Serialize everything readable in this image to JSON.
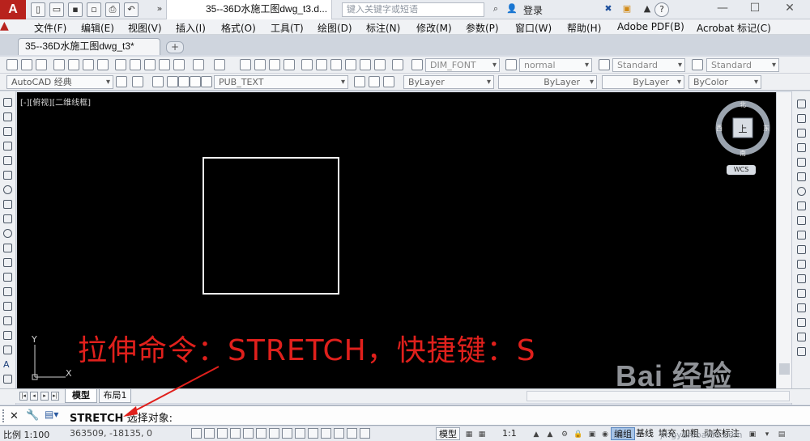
{
  "app": {
    "logo": "A",
    "document_title": "35--36D水施工图dwg_t3.d...",
    "search_placeholder": "键入关键字或短语",
    "login": "登录",
    "minimize": "—",
    "maximize": "☐",
    "close": "✕",
    "help": "?"
  },
  "menu": [
    "文件(F)",
    "编辑(E)",
    "视图(V)",
    "插入(I)",
    "格式(O)",
    "工具(T)",
    "绘图(D)",
    "标注(N)",
    "修改(M)",
    "参数(P)",
    "窗口(W)",
    "帮助(H)",
    "Adobe PDF(B)",
    "Acrobat 标记(C)"
  ],
  "tabs": {
    "file_tab": "35--36D水施工图dwg_t3*",
    "new_tab": "+"
  },
  "toolbar1": {
    "text_style": "DIM_FONT",
    "dim_style": "normal",
    "table_style": "Standard",
    "multileader_style": "Standard"
  },
  "toolbar2": {
    "workspace": "AutoCAD 经典",
    "layer": "PUB_TEXT",
    "color": "ByLayer",
    "linetype": "ByLayer",
    "lineweight": "ByLayer",
    "plotstyle": "ByColor"
  },
  "canvas": {
    "viewport_label": "[-][俯视][二维线框]",
    "caption": "拉伸命令：STRETCH，快捷键：S",
    "ucs_y": "Y",
    "ucs_x": "X",
    "compass": {
      "north": "北",
      "south": "南",
      "east": "东",
      "west": "西",
      "top": "上"
    },
    "wcs": "WCS"
  },
  "layout_tabs": [
    "模型",
    "布局1"
  ],
  "command": {
    "name": "STRETCH",
    "prompt": "选择对象:"
  },
  "status": {
    "scale": "比例 1:100",
    "coordinates": "363509, -18135, 0",
    "model": "模型",
    "annotation_scale": "1:1",
    "words": [
      "编组",
      "基线",
      "填充",
      "加粗",
      "动态标注"
    ]
  },
  "watermark": {
    "text": "Bai 经验",
    "url": "jingyan.baidu.com"
  },
  "colors": {
    "caption": "#e0201c",
    "canvas": "#000000",
    "accent": "#b8221d"
  }
}
